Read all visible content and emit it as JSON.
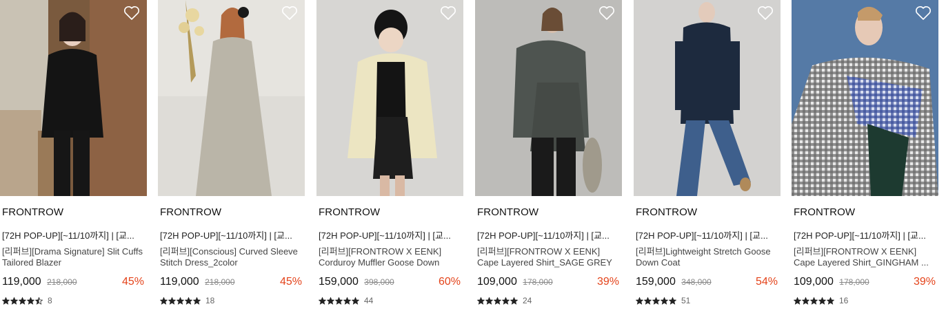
{
  "products": [
    {
      "brand": "FRONTROW",
      "tagline": "[72H POP-UP][~11/10까지] | [교...",
      "name": "[리퍼브][Drama Signature] Slit Cuffs Tailored Blazer",
      "price": "119,000",
      "original_price": "218,000",
      "discount": "45%",
      "rating": 4.5,
      "review_count": "8",
      "bg": "#8a6a4c"
    },
    {
      "brand": "FRONTROW",
      "tagline": "[72H POP-UP][~11/10까지] | [교...",
      "name": "[리퍼브][Conscious] Curved Sleeve Stitch Dress_2color",
      "price": "119,000",
      "original_price": "218,000",
      "discount": "45%",
      "rating": 5,
      "review_count": "18",
      "bg": "#dcdad5"
    },
    {
      "brand": "FRONTROW",
      "tagline": "[72H POP-UP][~11/10까지] | [교...",
      "name": "[리퍼브][FRONTROW X EENK] Corduroy Muffler Goose Down",
      "price": "159,000",
      "original_price": "398,000",
      "discount": "60%",
      "rating": 5,
      "review_count": "44",
      "bg": "#d6d5d2"
    },
    {
      "brand": "FRONTROW",
      "tagline": "[72H POP-UP][~11/10까지] | [교...",
      "name": "[리퍼브][FRONTROW X EENK] Cape Layered Shirt_SAGE GREY",
      "price": "109,000",
      "original_price": "178,000",
      "discount": "39%",
      "rating": 5,
      "review_count": "24",
      "bg": "#bcbbb8"
    },
    {
      "brand": "FRONTROW",
      "tagline": "[72H POP-UP][~11/10까지] | [교...",
      "name": "[리퍼브]Lightweight Stretch Goose Down Coat",
      "price": "159,000",
      "original_price": "348,000",
      "discount": "54%",
      "rating": 5,
      "review_count": "51",
      "bg": "#d2d1cf"
    },
    {
      "brand": "FRONTROW",
      "tagline": "[72H POP-UP][~11/10까지] | [교...",
      "name": "[리퍼브][FRONTROW X EENK] Cape Layered Shirt_GINGHAM ...",
      "price": "109,000",
      "original_price": "178,000",
      "discount": "39%",
      "rating": 5,
      "review_count": "16",
      "bg": "#5a7fa8"
    }
  ],
  "icons": {
    "wishlist": "heart-outline-icon",
    "rating": "star-icon"
  },
  "colors": {
    "discount": "#e4431a",
    "star": "#222222",
    "text": "#111111"
  }
}
